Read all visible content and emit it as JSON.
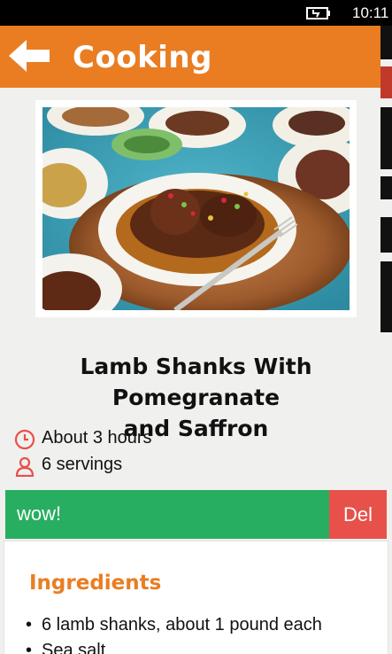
{
  "status_bar": {
    "time": "10:11",
    "battery_icon": "battery-charging-icon"
  },
  "app_bar": {
    "title": "Cooking",
    "back_icon": "back-arrow-icon"
  },
  "recipe": {
    "title_line1": "Lamb Shanks With Pomegranate",
    "title_line2": "and Saffron",
    "duration": "About 3 hours",
    "servings": "6 servings",
    "duration_icon": "clock-icon",
    "servings_icon": "person-icon"
  },
  "note": {
    "text": "wow!",
    "delete_label": "Del"
  },
  "ingredients": {
    "heading": "Ingredients",
    "items": [
      "6 lamb shanks, about 1 pound each",
      "Sea salt"
    ]
  },
  "colors": {
    "accent": "#ea7d22",
    "note_green": "#27ae60",
    "delete_red": "#e8504a"
  }
}
